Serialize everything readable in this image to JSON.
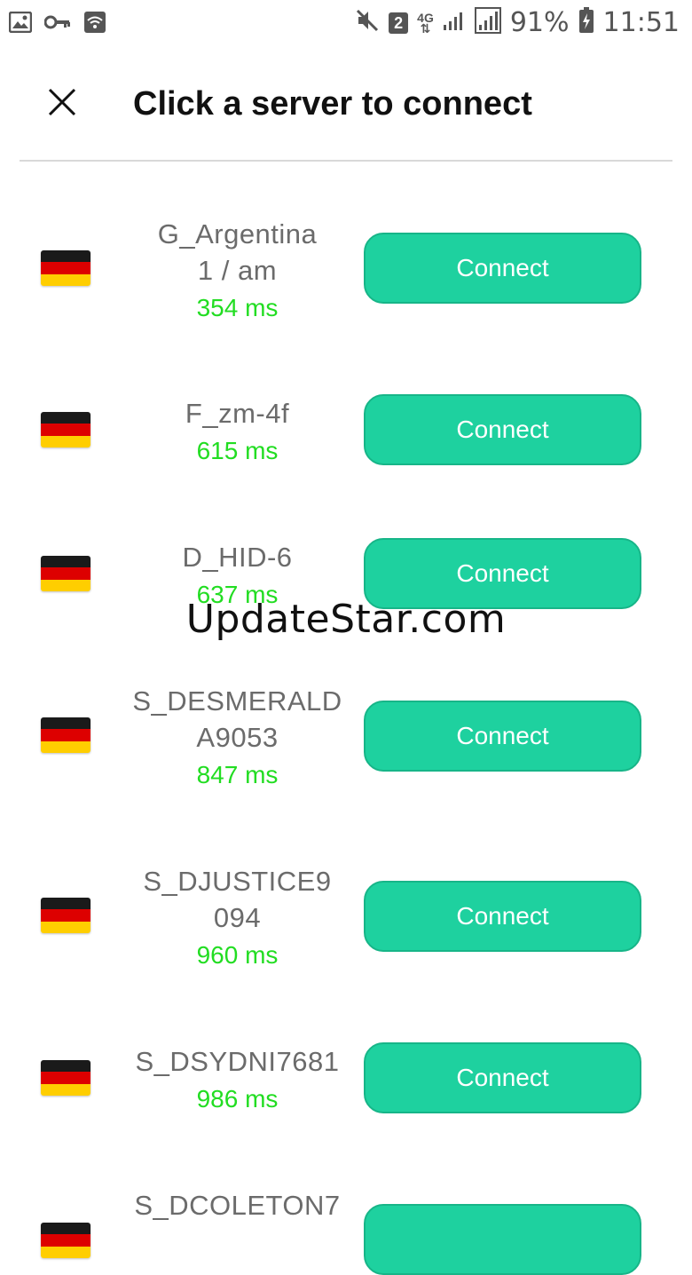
{
  "status_bar": {
    "sim_badge": "2",
    "network": "4G",
    "battery": "91%",
    "time": "11:51"
  },
  "header": {
    "title": "Click a server to connect"
  },
  "servers": [
    {
      "name_lines": [
        "G_Argentina",
        "1 / am"
      ],
      "ping": "354 ms",
      "flag": "germany",
      "button": "Connect"
    },
    {
      "name_lines": [
        "F_zm-4f"
      ],
      "ping": "615 ms",
      "flag": "germany",
      "button": "Connect"
    },
    {
      "name_lines": [
        "D_HID-6"
      ],
      "ping": "637 ms",
      "flag": "germany",
      "button": "Connect"
    },
    {
      "name_lines": [
        "S_DESMERALD",
        "A9053"
      ],
      "ping": "847 ms",
      "flag": "germany",
      "button": "Connect"
    },
    {
      "name_lines": [
        "S_DJUSTICE9",
        "094"
      ],
      "ping": "960 ms",
      "flag": "germany",
      "button": "Connect"
    },
    {
      "name_lines": [
        "S_DSYDNI7681"
      ],
      "ping": "986 ms",
      "flag": "germany",
      "button": "Connect"
    },
    {
      "name_lines": [
        "S_DCOLETON7"
      ],
      "ping": "",
      "flag": "germany",
      "button": ""
    }
  ],
  "watermark": "UpdateStar.com",
  "colors": {
    "accent": "#1ed19f",
    "ping": "#22dd22"
  }
}
